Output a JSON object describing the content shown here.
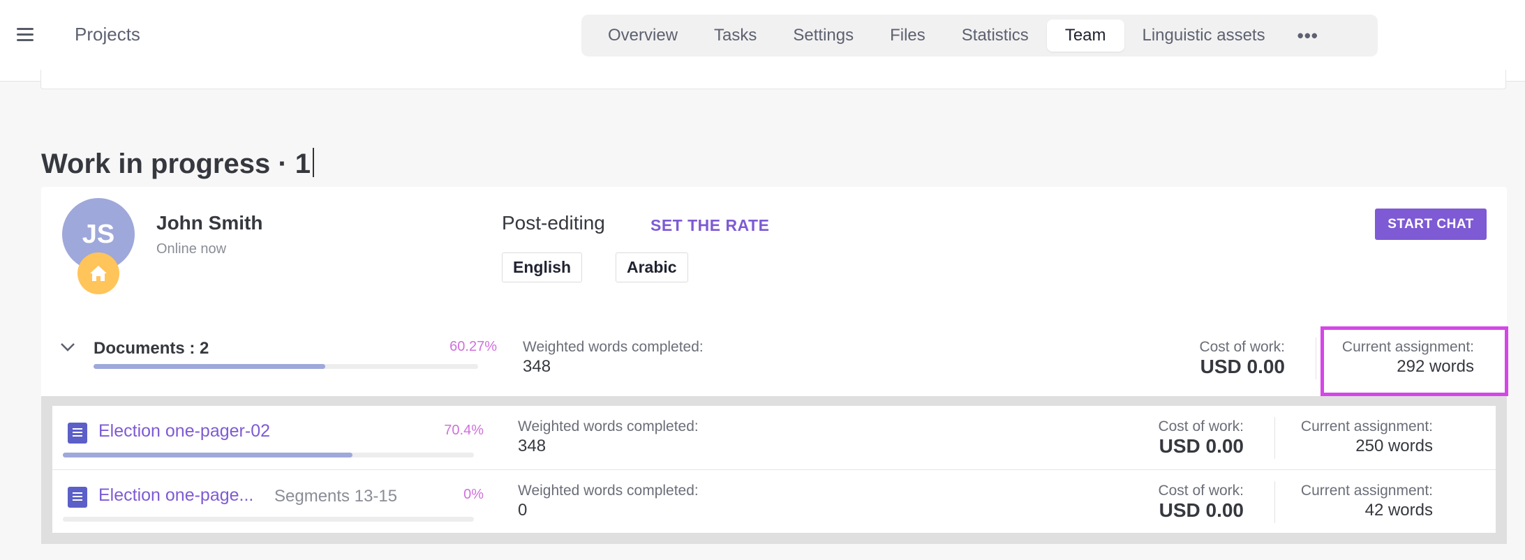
{
  "header": {
    "title": "Projects",
    "tabs": [
      "Overview",
      "Tasks",
      "Settings",
      "Files",
      "Statistics",
      "Team",
      "Linguistic assets"
    ],
    "active_tab": "Team"
  },
  "section": {
    "title": "Work in progress · 1"
  },
  "assignee": {
    "initials": "JS",
    "name": "John Smith",
    "status": "Online now",
    "avatar_color": "#9ea8da",
    "badge_icon": "home-icon",
    "badge_color": "#ffc45a"
  },
  "service": {
    "name": "Post-editing",
    "set_rate_label": "SET THE RATE",
    "source_language": "English",
    "target_language": "Arabic",
    "start_chat_label": "START CHAT"
  },
  "summary": {
    "documents_label": "Documents : 2",
    "progress_percent": "60.27%",
    "progress_fraction": 0.6027,
    "weighted_label": "Weighted words completed:",
    "weighted_value": "348",
    "cost_label": "Cost of work:",
    "cost_value": "USD 0.00",
    "assignment_label": "Current assignment:",
    "assignment_value": "292 words"
  },
  "documents": [
    {
      "name": "Election one-pager-02",
      "segments": "",
      "progress_percent": "70.4%",
      "progress_fraction": 0.704,
      "weighted_label": "Weighted words completed:",
      "weighted_value": "348",
      "cost_label": "Cost of work:",
      "cost_value": "USD 0.00",
      "assignment_label": "Current assignment:",
      "assignment_value": "250 words"
    },
    {
      "name": "Election one-page...",
      "segments": "Segments 13-15",
      "progress_percent": "0%",
      "progress_fraction": 0,
      "weighted_label": "Weighted words completed:",
      "weighted_value": "0",
      "cost_label": "Cost of work:",
      "cost_value": "USD 0.00",
      "assignment_label": "Current assignment:",
      "assignment_value": "42 words"
    }
  ],
  "colors": {
    "accent": "#7e5ad4",
    "percent": "#d070dc",
    "progress_fill": "#9ea8da",
    "highlight": "#d447e6"
  }
}
